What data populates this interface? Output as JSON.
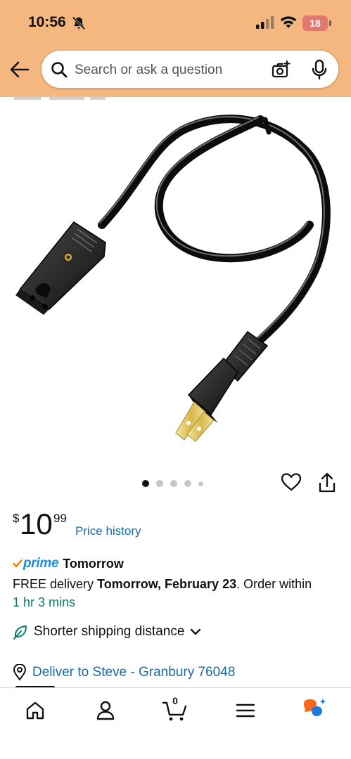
{
  "status_bar": {
    "time": "10:56",
    "battery": "18"
  },
  "search": {
    "placeholder": "Search or ask a question"
  },
  "product": {
    "image_alt": "Black two-prong appliance power cord",
    "carousel_dot_count": 5,
    "carousel_active_index": 0
  },
  "price": {
    "symbol": "$",
    "whole": "10",
    "fraction": "99",
    "history_link": "Price history"
  },
  "delivery": {
    "prime_word": "prime",
    "prime_day": "Tomorrow",
    "line_prefix": "FREE delivery ",
    "line_date": "Tomorrow, February 23",
    "line_suffix": ". Order within",
    "countdown": "1 hr 3 mins",
    "shipping_option": "Shorter shipping distance",
    "deliver_to": "Deliver to Steve - Granbury 76048"
  },
  "nav": {
    "cart_count": "0"
  },
  "colors": {
    "header_bg": "#f3b77f",
    "link": "#1b6aa5",
    "prime_blue": "#1a8ee6",
    "prime_check": "#f08804",
    "countdown_green": "#067d62",
    "rufus_orange": "#ff6a1a",
    "rufus_blue": "#1f7ae0"
  },
  "icons": [
    "back-arrow-icon",
    "search-icon",
    "camera-icon",
    "mic-icon",
    "heart-icon",
    "share-icon",
    "leaf-icon",
    "chevron-down-icon",
    "location-pin-icon",
    "home-icon",
    "profile-icon",
    "cart-icon",
    "menu-icon",
    "rufus-icon"
  ]
}
